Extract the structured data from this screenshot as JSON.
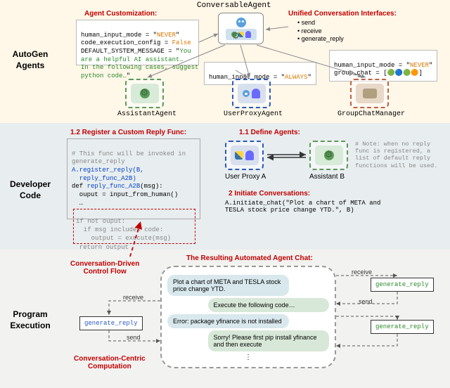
{
  "sections": {
    "agents_label": "AutoGen\nAgents",
    "dev_label": "Developer\nCode",
    "exec_label": "Program\nExecution"
  },
  "top": {
    "conversable_title": "ConversableAgent",
    "customization_label": "Agent Customization:",
    "unified_label": "Unified Conversation Interfaces:",
    "interfaces": [
      "send",
      "receive",
      "generate_reply"
    ],
    "code1_l1": "human_input_mode = \"",
    "code1_l1v": "NEVER",
    "code1_l2": "code_execution_config = ",
    "code1_l2v": "False",
    "code1_l3": "DEFAULT_SYSTEM_MESSAGE = \"",
    "code1_l3v": "You\nare a helpful AI assistant…\nIn the following cases, suggest\npython code…",
    "code2a": "human_input_mode = \"",
    "code2av": "ALWAYS",
    "code3a": "human_input_mode = \"",
    "code3av": "NEVER",
    "code3b": "group_chat = [",
    "code3bsym": "🟢🔵🟢🟠",
    "code3b2": "]",
    "assistant_label": "AssistantAgent",
    "userproxy_label": "UserProxyAgent",
    "groupchat_label": "GroupChatManager"
  },
  "dev": {
    "register_label": "1.2 Register a Custom Reply Func:",
    "define_label": "1.1 Define Agents:",
    "note_l1": "# Note: when no reply",
    "note_l2": "func is registered, a",
    "note_l3": "list of default reply",
    "note_l4": "functions will be used.",
    "code_c1": "# This func will be invoked in\ngenerate_reply",
    "code_l1": "A.register_reply(B,\n  reply_func_A2B)",
    "code_def": "def ",
    "code_fn": "reply_func_A2B",
    "code_sig": "(msg):",
    "code_body": "  ouput = input_from_human()\n  …",
    "code_box_l1": "if not ouput:",
    "code_box_l2": "  if msg includes code:",
    "code_box_l3": "    output = execute(msg)",
    "code_ret": "  return output",
    "proxy_a": "User Proxy A",
    "assistant_b": "Assistant B",
    "initiate_label": "2 Initiate Conversations:",
    "initiate_code": "A.initiate_chat(\"Plot a chart of META and\nTESLA stock price change YTD.\", B)"
  },
  "flow_label": "Conversation-Driven\nControl Flow",
  "exec": {
    "title": "The Resulting Automated Agent Chat:",
    "msg1": "Plot a chart of META and TESLA stock price change YTD.",
    "msg2": "Execute the following code…",
    "msg3": "Error: package yfinance is not installed",
    "msg4": "Sorry! Please first pip install yfinance and then execute",
    "gen_reply_l": "generate_reply",
    "gen_reply_r1": "generate_reply",
    "gen_reply_r2": "generate_reply",
    "recv_l": "receive",
    "send_l": "send",
    "recv_r": "receive",
    "send_r": "send",
    "comp_label": "Conversation-Centric\nComputation"
  }
}
